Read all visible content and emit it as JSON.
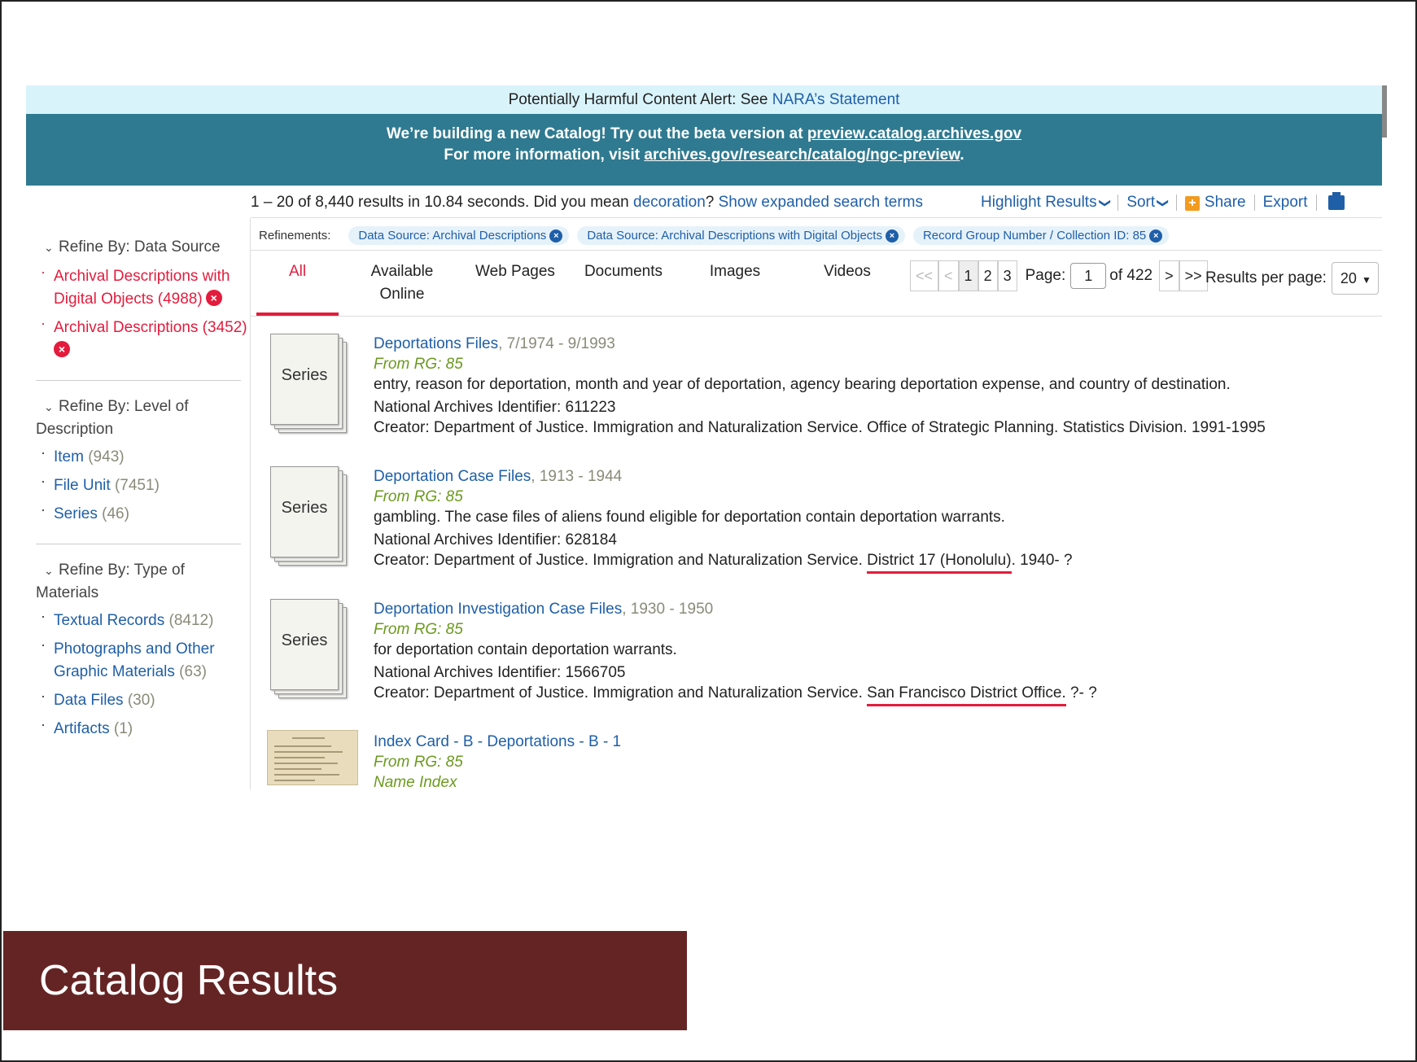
{
  "alert": {
    "prefix": "Potentially Harmful Content Alert: See ",
    "link": "NARA’s Statement"
  },
  "beta": {
    "line1_prefix": "We’re building a new Catalog! Try out the beta version at ",
    "line1_link": "preview.catalog.archives.gov",
    "line2_prefix": "For more information, visit ",
    "line2_link": "archives.gov/research/catalog/ngc-preview",
    "line2_suffix": "."
  },
  "summary": {
    "text": "1 – 20 of 8,440 results in 10.84 seconds. Did you mean ",
    "suggestion": "decoration",
    "qmark": "?",
    "expanded": "Show expanded search terms"
  },
  "tools": {
    "highlight": "Highlight Results",
    "sort": "Sort",
    "share": "Share",
    "export": "Export"
  },
  "sidebar": {
    "data_source": {
      "title": "Refine By: Data Source",
      "items": [
        {
          "label": "Archival Descriptions with",
          "label2": "Digital Objects (4988)"
        },
        {
          "label": "Archival Descriptions (3452)"
        }
      ]
    },
    "level": {
      "title": "Refine By: Level of",
      "title2": "Description",
      "items": [
        {
          "label": "Item",
          "count": "(943)"
        },
        {
          "label": "File Unit",
          "count": "(7451)"
        },
        {
          "label": "Series",
          "count": "(46)"
        }
      ]
    },
    "materials": {
      "title": "Refine By: Type of",
      "title2": "Materials",
      "items": [
        {
          "label": "Textual Records",
          "count": "(8412)"
        },
        {
          "label": "Photographs and Other",
          "label2": "Graphic Materials",
          "count": "(63)"
        },
        {
          "label": "Data Files",
          "count": "(30)"
        },
        {
          "label": "Artifacts",
          "count": "(1)"
        }
      ]
    }
  },
  "refinements": {
    "label": "Refinements:",
    "chips": [
      "Data Source: Archival Descriptions",
      "Data Source: Archival Descriptions with Digital Objects",
      "Record Group Number / Collection ID: 85"
    ]
  },
  "tabs": [
    {
      "label": "All"
    },
    {
      "label": "Available",
      "label2": "Online"
    },
    {
      "label": "Web Pages"
    },
    {
      "label": "Documents"
    },
    {
      "label": "Images"
    },
    {
      "label": "Videos"
    }
  ],
  "pager": {
    "first": "<<",
    "prev": "<",
    "pages": [
      "1",
      "2",
      "3"
    ],
    "page_label": "Page:",
    "page_value": "1",
    "of_label": "of 422",
    "next": ">",
    "last": ">>"
  },
  "rpp": {
    "label": "Results per page:",
    "value": "20"
  },
  "results": [
    {
      "thumb": "Series",
      "title": "Deportations Files",
      "date": ", 7/1974 - 9/1993",
      "rg": "From RG: 85",
      "desc": "entry, reason for deportation, month and year of deportation, agency bearing deportation expense, and country of destination.",
      "naid": "National Archives Identifier: 611223",
      "creator_pre": "Creator: Department of Justice. Immigration and Naturalization Service. Office of Strategic Planning. Statistics Division. 1991-1995",
      "creator_hl": "",
      "creator_post": ""
    },
    {
      "thumb": "Series",
      "title": "Deportation Case Files",
      "date": ", 1913 - 1944",
      "rg": "From RG: 85",
      "desc": "gambling. The case files of aliens found eligible for deportation contain deportation warrants.",
      "naid": "National Archives Identifier: 628184",
      "creator_pre": "Creator: Department of Justice. Immigration and Naturalization Service. ",
      "creator_hl": "District 17 (Honolulu)",
      "creator_post": ". 1940- ?"
    },
    {
      "thumb": "Series",
      "title": "Deportation Investigation Case Files",
      "date": ", 1930 - 1950",
      "rg": "From RG: 85",
      "desc": "for deportation contain deportation warrants.",
      "naid": "National Archives Identifier: 1566705",
      "creator_pre": "Creator: Department of Justice. Immigration and Naturalization Service. ",
      "creator_hl": "San Francisco District Office.",
      "creator_post": " ?- ?"
    },
    {
      "title": "Index Card - B - Deportations - B - 1",
      "rg": "From RG: 85",
      "sub": "Name Index"
    }
  ],
  "caption": "Catalog Results",
  "colors": {
    "link": "#1f5fa8",
    "accent_red": "#e31c3d",
    "banner": "#2f7a90",
    "caption_bg": "#652424",
    "rg_green": "#6b9a1e"
  }
}
